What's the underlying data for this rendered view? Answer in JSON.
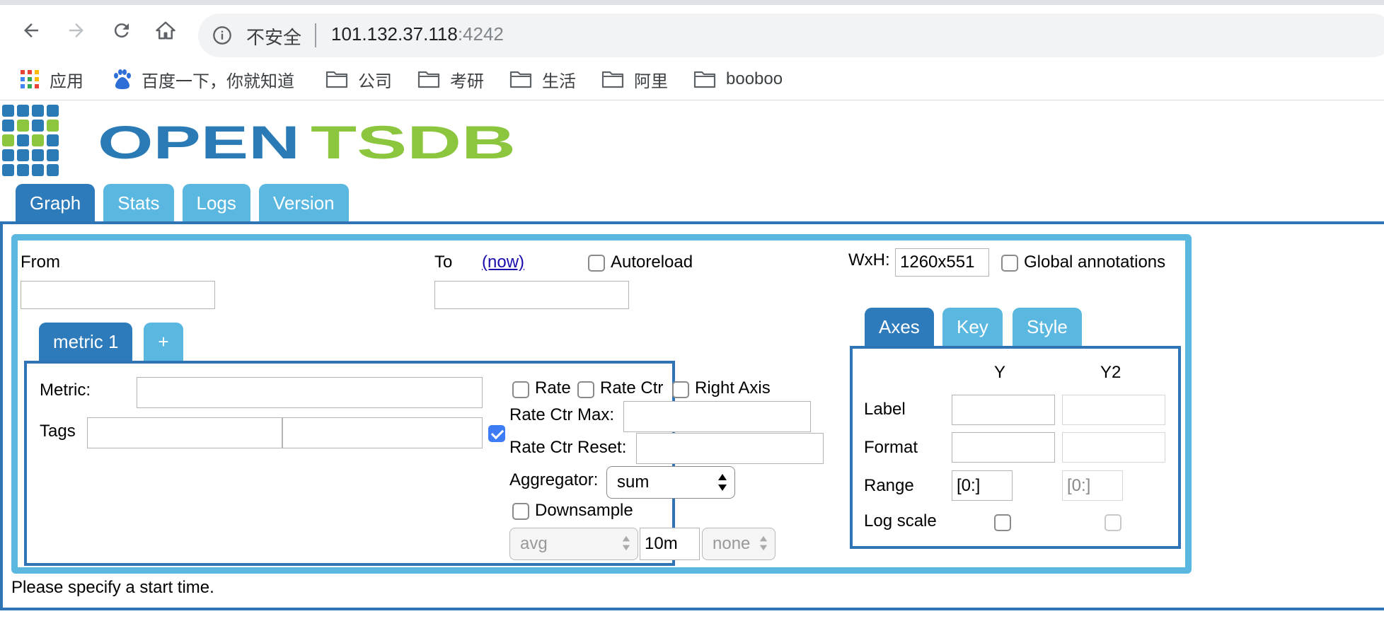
{
  "browser": {
    "security_label": "不安全",
    "url_host": "101.132.37.118",
    "url_port": ":4242",
    "bookmarks": [
      {
        "label": "应用",
        "icon": "apps-grid-icon"
      },
      {
        "label": "百度一下，你就知道",
        "icon": "baidu-paw-icon"
      },
      {
        "label": "公司",
        "icon": "folder-icon"
      },
      {
        "label": "考研",
        "icon": "folder-icon"
      },
      {
        "label": "生活",
        "icon": "folder-icon"
      },
      {
        "label": "阿里",
        "icon": "folder-icon"
      },
      {
        "label": "booboo",
        "icon": "folder-icon"
      }
    ]
  },
  "logo": {
    "text_open": "OPEN",
    "text_tsdb": "TSDB"
  },
  "top_tabs": [
    {
      "label": "Graph",
      "active": true
    },
    {
      "label": "Stats",
      "active": false
    },
    {
      "label": "Logs",
      "active": false
    },
    {
      "label": "Version",
      "active": false
    }
  ],
  "time": {
    "from_label": "From",
    "from_value": "",
    "to_label": "To",
    "now_link": "(now)",
    "to_value": "",
    "autoreload_label": "Autoreload",
    "autoreload_checked": false
  },
  "size": {
    "wxh_label": "WxH:",
    "wxh_value": "1260x551",
    "global_annotations_label": "Global annotations"
  },
  "metric_tabs": [
    {
      "label": "metric 1",
      "active": true
    },
    {
      "label": "+",
      "active": false
    }
  ],
  "metric_form": {
    "metric_label": "Metric:",
    "metric_value": "",
    "tags_label": "Tags",
    "tag_key": "",
    "tag_value": "",
    "tag_group_checked": true,
    "rate_label": "Rate",
    "rate_ctr_label": "Rate Ctr",
    "right_axis_label": "Right Axis",
    "rate_ctr_max_label": "Rate Ctr Max:",
    "rate_ctr_max_value": "",
    "rate_ctr_reset_label": "Rate Ctr Reset:",
    "rate_ctr_reset_value": "",
    "aggregator_label": "Aggregator:",
    "aggregator_value": "sum",
    "downsample_label": "Downsample",
    "downsample_agg": "avg",
    "downsample_interval": "10m",
    "downsample_fill": "none"
  },
  "axes_tabs": [
    {
      "label": "Axes",
      "active": true
    },
    {
      "label": "Key",
      "active": false
    },
    {
      "label": "Style",
      "active": false
    }
  ],
  "axes": {
    "col_y": "Y",
    "col_y2": "Y2",
    "label_row": "Label",
    "format_row": "Format",
    "range_row": "Range",
    "range_y": "[0:]",
    "range_y2": "[0:]",
    "log_scale_row": "Log scale"
  },
  "status_message": "Please specify a start time.",
  "colors": {
    "tab_active": "#2d7bba",
    "tab_inactive": "#5ab8e0",
    "logo_blue": "#2a7ab5",
    "logo_green": "#8cc63f"
  }
}
